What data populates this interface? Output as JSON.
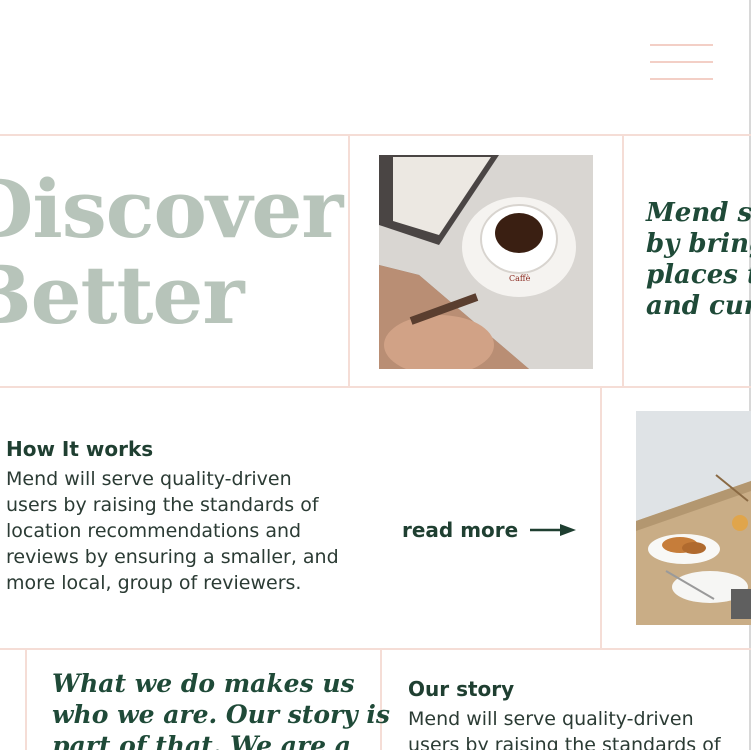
{
  "header": {
    "menu_icon": "hamburger-menu-icon"
  },
  "hero": {
    "line1": "Discover",
    "line2": "Better"
  },
  "tagline": {
    "line1": "Mend sta",
    "line2": "by bringi",
    "line3": "places to",
    "line4": "and curio"
  },
  "how_it_works": {
    "title": "How It works",
    "lines": [
      "Mend will serve quality-driven",
      "users by raising the standards of",
      "location recommendations and",
      "reviews by ensuring a smaller, and",
      "more local, group of reviewers."
    ],
    "read_more_label": "read more",
    "arrow_icon": "arrow-right-icon"
  },
  "what_we_do": {
    "line1": "What we do makes us",
    "line2": "who we are. Our story is",
    "line3": "part of that. We are a"
  },
  "our_story": {
    "title": "Our story",
    "line1": "Mend will serve quality-driven",
    "line2": "users by raising the standards of"
  },
  "colors": {
    "accent_line": "#f5ddd6",
    "hero_text": "#b7c4ba",
    "dark_green": "#1f4a38"
  }
}
